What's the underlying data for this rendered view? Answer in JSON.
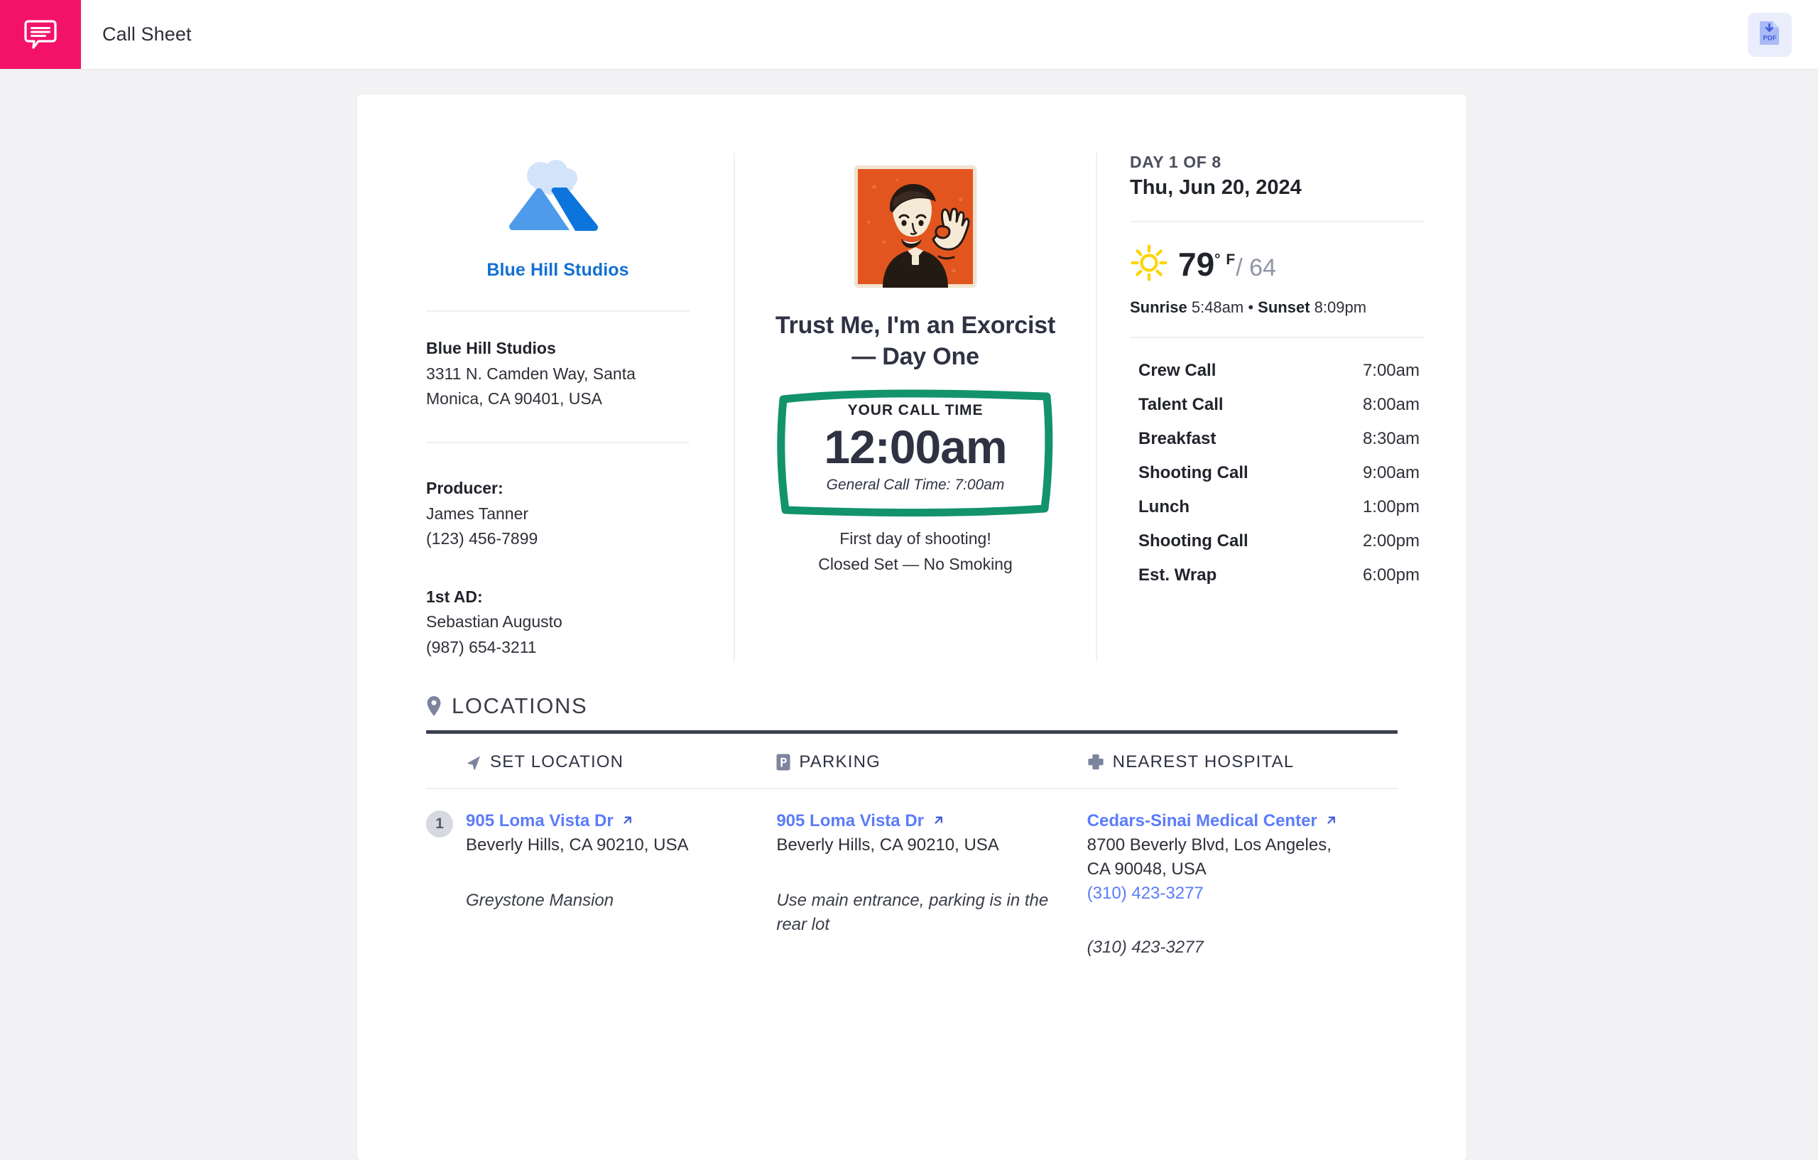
{
  "topbar": {
    "app_icon": "speech-bubble-icon",
    "title": "Call Sheet",
    "pdf_label": "PDF",
    "brand_color": "#f31269"
  },
  "company": {
    "logo_icon": "blue-hill-studios-logo",
    "logo_name": "Blue Hill Studios",
    "name": "Blue Hill Studios",
    "address_line1": "3311 N. Camden Way, Santa",
    "address_line2": "Monica, CA 90401, USA",
    "contacts": [
      {
        "role": "Producer:",
        "name": "James Tanner",
        "phone": "(123) 456-7899"
      },
      {
        "role": "1st AD:",
        "name": "Sebastian Augusto",
        "phone": "(987) 654-3211"
      }
    ]
  },
  "production": {
    "poster_icon": "exorcist-priest-poster",
    "title": "Trust Me, I'm an Exorcist — Day One",
    "call_time_label": "YOUR CALL TIME",
    "call_time": "12:00am",
    "general_call_time": "General Call Time: 7:00am",
    "notes_line1": "First day of shooting!",
    "notes_line2": "Closed Set — No Smoking",
    "accent_color": "#12936c"
  },
  "day": {
    "day_of": "DAY 1 OF 8",
    "date": "Thu, Jun 20, 2024"
  },
  "weather": {
    "icon": "sun-icon",
    "high": "79",
    "unit": "° F",
    "low": "/ 64",
    "sunrise_label": "Sunrise",
    "sunrise": "5:48am",
    "separator": "•",
    "sunset_label": "Sunset",
    "sunset": "8:09pm"
  },
  "schedule": [
    {
      "name": "Crew Call",
      "time": "7:00am"
    },
    {
      "name": "Talent Call",
      "time": "8:00am"
    },
    {
      "name": "Breakfast",
      "time": "8:30am"
    },
    {
      "name": "Shooting Call",
      "time": "9:00am"
    },
    {
      "name": "Lunch",
      "time": "1:00pm"
    },
    {
      "name": "Shooting Call",
      "time": "2:00pm"
    },
    {
      "name": "Est. Wrap",
      "time": "6:00pm"
    }
  ],
  "locations": {
    "section_icon": "map-pin-icon",
    "section_title": "LOCATIONS",
    "columns": [
      {
        "icon": "navigation-arrow-icon",
        "label": "SET LOCATION"
      },
      {
        "icon": "parking-p-icon",
        "label": "PARKING"
      },
      {
        "icon": "hospital-cross-icon",
        "label": "NEAREST HOSPITAL"
      }
    ],
    "rows": [
      {
        "index": "1",
        "set": {
          "link": "905 Loma Vista Dr",
          "address": "Beverly Hills, CA 90210, USA",
          "note": "Greystone Mansion"
        },
        "parking": {
          "link": "905 Loma Vista Dr",
          "address": "Beverly Hills, CA 90210, USA",
          "note": "Use main entrance, parking is in the rear lot"
        },
        "hospital": {
          "link": "Cedars-Sinai Medical Center",
          "address_line1": "8700 Beverly Blvd, Los Angeles,",
          "address_line2": "CA 90048, USA",
          "phone": "(310) 423-3277",
          "note": "(310) 423-3277"
        }
      }
    ]
  }
}
